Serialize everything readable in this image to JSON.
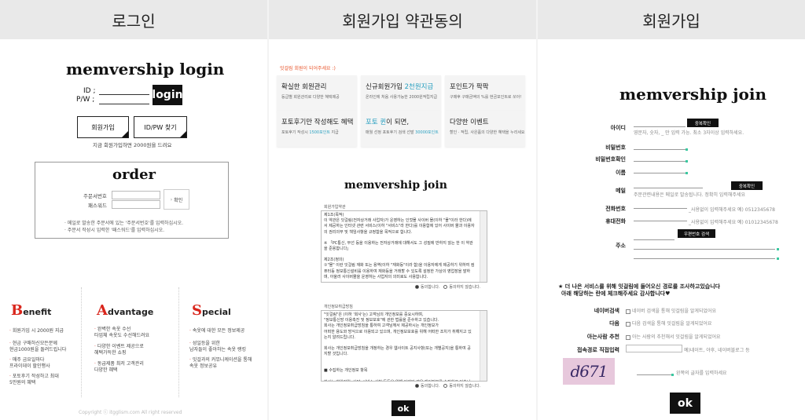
{
  "headers": {
    "login": "로그인",
    "terms": "회원가입 약관동의",
    "join": "회원가입"
  },
  "login": {
    "title": "memvership login",
    "id_label": "ID ;",
    "pw_label": "P/W ;",
    "login_btn": "login",
    "join_btn": "회원가입",
    "find_btn": "ID/PW 찾기",
    "bonus_note": "지금 회원가입하면 2000원을 드려요"
  },
  "order": {
    "title": "order",
    "order_no_label": "주문서번호",
    "password_label": "패스워드",
    "confirm_btn": "확인",
    "notes": [
      "· 메일로 발송한 주문서에 있는 '주문서번호'를 입력하십시오.",
      "· 주문서 작성시 입력한 '패스워드'를 입력하십시오."
    ]
  },
  "benefits": [
    {
      "letter": "B",
      "rest": "enefit",
      "items": [
        "회원가입 시 2000원 지급",
        "현금 구매하신모든분께\n현금1000원을 돌려드립니다",
        "매주 금요일마다\n프라이데이 할인행사",
        "포토후기 작성하고 최대\n5만원의 혜택"
      ]
    },
    {
      "letter": "A",
      "rest": "dvantage",
      "items": [
        "완벽한 속옷 수선\n타업체 속옷도 수선해드려요",
        "다양한 이벤트 제공으로\n혜택가득한 쇼핑",
        "동급제품 최저 고객관리\n다양한 혜택"
      ]
    },
    {
      "letter": "S",
      "rest": "pecial",
      "items": [
        "속옷에 대한 모든 정보제공",
        "성일등을 위한\n남자들이 좋아하는 속옷 랭킹",
        "잇걸과의 커뮤니케이션을 통해\n속옷 정보공유"
      ]
    }
  ],
  "copyright": "Copyright ⓒ itgglism.com All right reserved",
  "terms": {
    "intro": "잇걸림 회원이 되어주세요 :)",
    "features": [
      {
        "title": "확실한 회원관리",
        "desc": "등급별 회원관리로 다양한 혜택제공"
      },
      {
        "title_pre": "신규회원가입 ",
        "title_hl": "2천원지급",
        "desc": "온라인에 처음 사용가능한 2000원적립지급"
      },
      {
        "title": "포인트가 팍팍",
        "desc": "구매후 구매금액의 %를 현금포인트로 쏘아!"
      },
      {
        "title": "포토후기만 작성해도 혜택",
        "desc_pre": "포토후기 작성시 ",
        "desc_hl": "1500포인트",
        "desc_post": " 지급"
      },
      {
        "title_hl": "포토 퀸",
        "title_post": "이 되면,",
        "desc_pre": "매월 선정 포토후기 검색 선발 ",
        "desc_hl": "30000포인트"
      },
      {
        "title": "다양한 이벤트",
        "desc": "할인 · 적립, 사은품의 다양한 혜택을 누리세요"
      }
    ],
    "join_title": "memvership join",
    "box1_title": "회원가입약관",
    "box1_lines": [
      "제1조(목적)",
      "이 약관은 잇걸림(전자상거래 사업자)가 운영하는 인젓몰 사이버 몰(이하 \"몰\"이라 한다)에",
      "서 제공하는 인터넷 관련 서비스(이하 \"서비스\"라 한다)를 이용함에 있어 사이버 몰과 이용자",
      "의 권리의무 및 책임사항을 규정함을 목적으로 합니다.",
      "",
      "※ 「PC통신, 무선 등을 이용하는 전자상거래에 대해서도 그 성질에 반하지 않는 한 이 약관",
      "을 준용합니다」",
      "",
      "제2조(정의)",
      "①\"몰\" 이란 잇걸림 재화 또는 용역(이하 \"재화등\"이라 함)을 이용자에게 제공하기 위하여 컴",
      "퓨터등 정보통신설비를 이용하여 재화등을 거래할 수 있도록 설정한 가상의 영업장을 말하",
      "며, 아울러 사이버몰을 운영하는 사업자의 의미로도 사용합니다.",
      "",
      "②\"이용자\"란 \"몰\"에 접속하여 이 약관에 따라 \"몰\"이 제공하는 서비스를 받는 회원 및 비회",
      "원을 말합니다."
    ],
    "agree": "동의합니다.",
    "disagree": "동의하지 않습니다.",
    "box2_title": "개인정보취급방침",
    "box2_lines": [
      "\"잇걸림\"은 (이하 '회사'는) 고객님의 개인정보를 중요시하며,",
      "\"정보통신망 이용촉진 및 정보보호\"에 관한 법률을 준수하고 있습니다.",
      "회사는 개인정보취급방침을 통하여 고객님께서 제공하시는 개인정보가",
      "어떠한 용도와 방식으로 이용되고 있으며, 개인정보보호를 위해 어떠한 조치가 취해지고 있",
      "는지 알려드립니다.",
      "",
      "회사는 개인정보취급방침을 개정하는 경우 웹사이트 공지사항(또는 개별공지)을 통하여 공",
      "지할 것입니다.",
      "",
      "",
      "■ 수집하는 개인정보 항목",
      "",
      "회사는 회원가입, 상담, 서비스 신청 등등을 위해 아래와 같은 개인정보를 수집하고 있습니",
      "다."
    ],
    "ok": "ok"
  },
  "join": {
    "title": "memvership join",
    "fields": [
      {
        "label": "아이디",
        "button": "중복확인",
        "hint": "영문자, 숫자, _ 만 입력 가능. 최소 3자이상 입력하세요."
      },
      {
        "label": "비밀번호"
      },
      {
        "label": "비밀번호확인"
      },
      {
        "label": "이름"
      },
      {
        "label": "메일",
        "button": "중복확인",
        "hint": "주문관련내용은 메일로 발송됩니다. 정확히 입력해주세요"
      },
      {
        "label": "전화번호",
        "hint": "_사용없이 입력해주세요 예) 0512345678"
      },
      {
        "label": "휴대전화",
        "hint": "_사용없이 입력해주세요 예) 01012345678"
      },
      {
        "label": "주소",
        "button": "우편번호 검색"
      }
    ],
    "survey_title": "★ 더 나은 서비스를 위해 잇걸림에 들어오신 경로를 조사하고있습니다",
    "survey_sub": "아래 해당하는 란에 체크해주세요 감사합니다♥",
    "survey": [
      {
        "label": "네이버검색",
        "text": "네이버 검색을 통해 잇걸림을 알게되었어요"
      },
      {
        "label": "다음",
        "text": "다음 검색을 통해 잇걸림을 알게되었어요"
      },
      {
        "label": "아는사람 추천",
        "text": "아는 사람의 추천해서 잇걸림을 알게되었어요"
      },
      {
        "label": "접속경로 직접입력",
        "text": "예)네이트, 야후, 네이버블로그 등"
      }
    ],
    "captcha_text": "d671",
    "captcha_hint": "왼쪽의 글자를 입력하세요",
    "ok": "ok"
  }
}
